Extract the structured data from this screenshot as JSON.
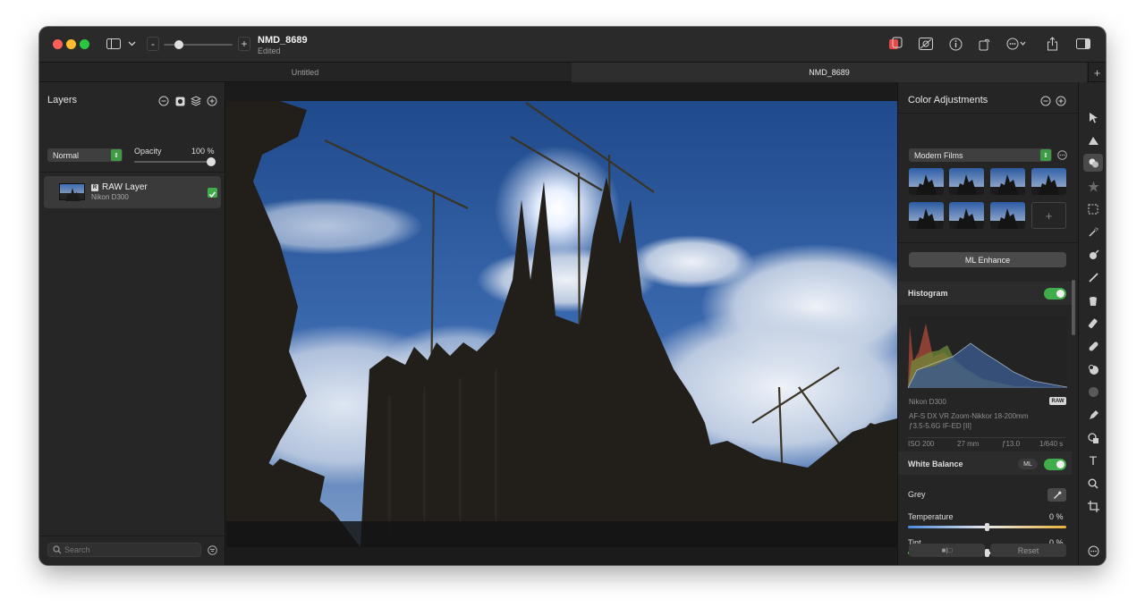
{
  "window": {
    "title": "NMD_8689",
    "subtitle": "Edited"
  },
  "tabs": [
    {
      "label": "Untitled",
      "active": false
    },
    {
      "label": "NMD_8689",
      "active": true
    }
  ],
  "toolbar_top": {
    "zoom_minus": "-",
    "zoom_plus": "+",
    "zoom_level": 0.18,
    "icons": [
      "sidebar-icon",
      "chevron-down-icon",
      "compare-icon",
      "mask-icon",
      "info-icon",
      "rotate-icon",
      "more-icon",
      "share-icon",
      "inspector-icon"
    ]
  },
  "layers_panel": {
    "title": "Layers",
    "blend_mode": "Normal",
    "opacity_label": "Opacity",
    "opacity_value": "100 %",
    "opacity_fraction": 1.0,
    "layers": [
      {
        "name": "RAW Layer",
        "subtitle": "Nikon D300",
        "checked": true
      }
    ],
    "search_placeholder": "Search"
  },
  "adjustments_panel": {
    "title": "Color Adjustments",
    "preset_group": "Modern Films",
    "preset_add": "+",
    "ml_enhance": "ML Enhance",
    "histogram": {
      "label": "Histogram",
      "enabled": true,
      "camera": "Nikon D300",
      "badge": "RAW",
      "lens_line1": "AF-S DX VR Zoom-Nikkor 18-200mm",
      "lens_line2": "ƒ3.5-5.6G IF-ED [II]",
      "iso": "ISO 200",
      "focal": "27 mm",
      "aperture": "ƒ13.0",
      "shutter": "1/640 s"
    },
    "white_balance": {
      "label": "White Balance",
      "ml_badge": "ML",
      "enabled": true,
      "grey_label": "Grey",
      "temperature_label": "Temperature",
      "temperature_value": "0 %",
      "temperature_fraction": 0.5,
      "tint_label": "Tint",
      "tint_value": "0 %",
      "tint_fraction": 0.5
    },
    "footer": {
      "compare_label": "■|□",
      "reset_label": "Reset"
    }
  },
  "tools": [
    "arrow-icon",
    "color-select-icon",
    "adjust-icon",
    "star-icon",
    "marquee-icon",
    "magic-wand-icon",
    "repair-icon",
    "brush-icon",
    "bucket-icon",
    "eraser-icon",
    "bandage-icon",
    "clone-icon",
    "sphere-icon",
    "pen-icon",
    "shapes-icon",
    "text-icon",
    "zoom-icon",
    "crop-icon",
    "more-tools-icon"
  ],
  "colors": {
    "accent_green": "#3fae4a",
    "sky_blue": "#2f5b9c",
    "window_bg": "#1e1e1e"
  }
}
